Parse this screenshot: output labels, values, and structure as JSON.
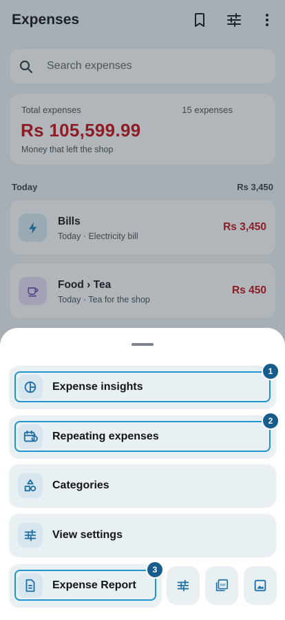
{
  "header": {
    "title": "Expenses",
    "icons": [
      "bookmark-icon",
      "tune-icon",
      "more-vert-icon"
    ]
  },
  "search": {
    "placeholder": "Search expenses"
  },
  "summary": {
    "label": "Total expenses",
    "count": "15 expenses",
    "amount": "Rs 105,599.99",
    "subtitle": "Money that left the shop"
  },
  "day_group": {
    "label": "Today",
    "total": "Rs 3,450"
  },
  "expenses": [
    {
      "name": "Bills",
      "meta": "Today · Electricity bill",
      "amount": "Rs 3,450",
      "icon": "bolt-icon"
    },
    {
      "name": "Food › Tea",
      "meta": "Today · Tea for the shop",
      "amount": "Rs 450",
      "icon": "cup-icon"
    }
  ],
  "sheet": {
    "items": [
      {
        "label": "Expense insights",
        "icon": "pie-chart-icon",
        "badge": "1"
      },
      {
        "label": "Repeating expenses",
        "icon": "calendar-repeat-icon",
        "badge": "2"
      },
      {
        "label": "Categories",
        "icon": "shapes-icon"
      },
      {
        "label": "View settings",
        "icon": "tune-icon"
      }
    ],
    "report": {
      "label": "Expense Report",
      "icon": "document-icon",
      "badge": "3"
    },
    "actions": [
      "tune-icon",
      "pdf-icon",
      "image-icon"
    ]
  },
  "colors": {
    "accent": "#1f93d3",
    "badge": "#175c8d",
    "negative": "#c4161c"
  }
}
